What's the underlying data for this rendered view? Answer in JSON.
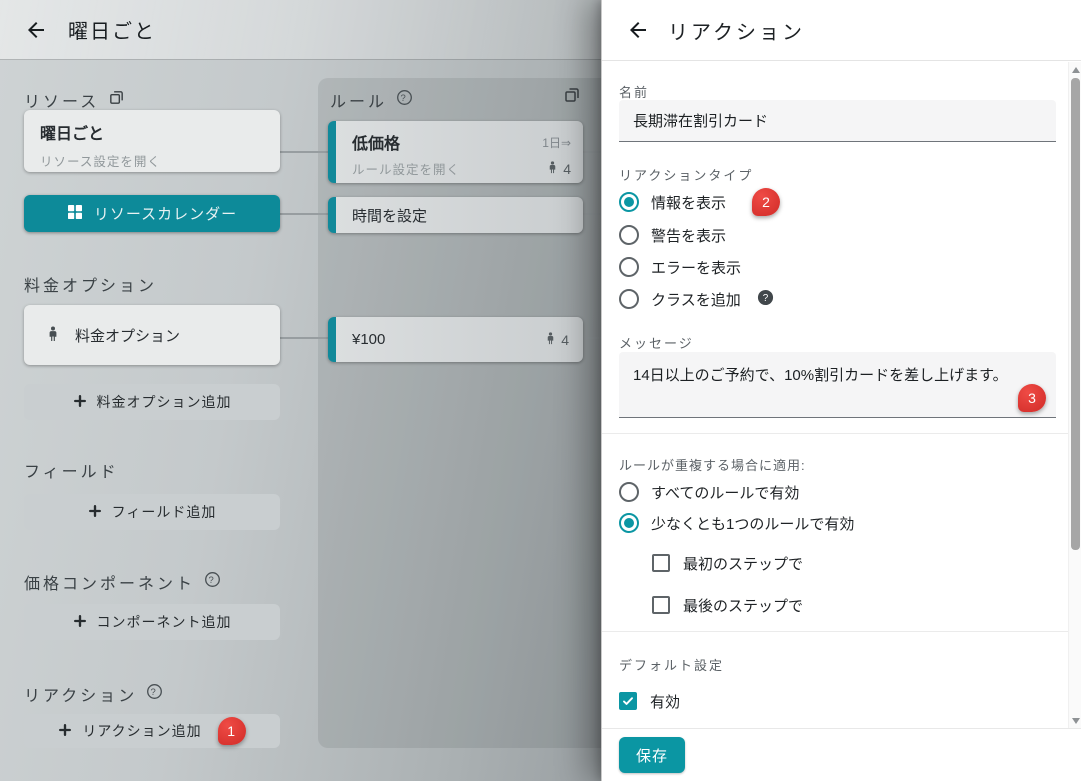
{
  "colors": {
    "accent": "#0b96a3",
    "accent_dim": "#0d8a99",
    "teal_bar": "#11899a",
    "badge_red": "#d93430"
  },
  "page": {
    "title": "曜日ごと",
    "resource_section": {
      "label": "リソース"
    },
    "resource_card": {
      "title": "曜日ごと",
      "subtitle": "リソース設定を開く"
    },
    "calendar_button": {
      "label": "リソースカレンダー"
    },
    "rule_section": {
      "label": "ルール"
    },
    "rule_cards": [
      {
        "title": "低価格",
        "subtitle": "ルール設定を開く",
        "duration": "1日⇒",
        "guests": "4"
      },
      {
        "title": "時間を設定"
      },
      {
        "title": "¥100",
        "guests": "4"
      }
    ],
    "price_option_section": {
      "label": "料金オプション"
    },
    "price_option_card": {
      "label": "料金オプション"
    },
    "add_price_option_button": "料金オプション追加",
    "field_section": {
      "label": "フィールド"
    },
    "add_field_button": "フィールド追加",
    "component_section": {
      "label": "価格コンポーネント"
    },
    "add_component_button": "コンポーネント追加",
    "reaction_section": {
      "label": "リアクション"
    },
    "add_reaction_button": "リアクション追加"
  },
  "badges": {
    "add_reaction": "1",
    "type_info": "2",
    "message": "3"
  },
  "drawer": {
    "title": "リアクション",
    "name": {
      "label": "名前",
      "value": "長期滞在割引カード"
    },
    "reaction_type": {
      "label": "リアクションタイプ",
      "options": [
        {
          "label": "情報を表示",
          "selected": true
        },
        {
          "label": "警告を表示",
          "selected": false
        },
        {
          "label": "エラーを表示",
          "selected": false
        },
        {
          "label": "クラスを追加",
          "selected": false,
          "has_help": true
        }
      ]
    },
    "message": {
      "label": "メッセージ",
      "value": "14日以上のご予約で、10%割引カードを差し上げます。"
    },
    "overlap": {
      "label": "ルールが重複する場合に適用:",
      "options": [
        {
          "label": "すべてのルールで有効",
          "selected": false
        },
        {
          "label": "少なくとも1つのルールで有効",
          "selected": true
        }
      ],
      "checkboxes": [
        {
          "label": "最初のステップで",
          "checked": false
        },
        {
          "label": "最後のステップで",
          "checked": false
        }
      ]
    },
    "defaults": {
      "label": "デフォルト設定",
      "enabled": {
        "label": "有効",
        "checked": true
      }
    },
    "save_button": "保存"
  }
}
